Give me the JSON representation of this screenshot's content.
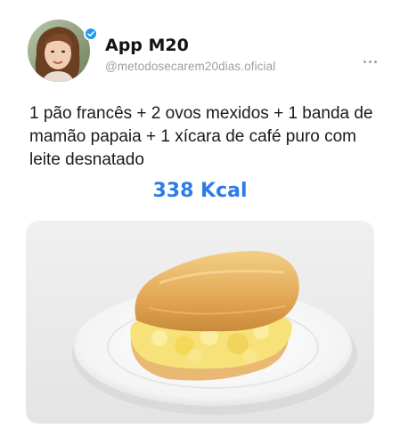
{
  "account": {
    "name": "App M20",
    "handle": "@metodosecarem20dias.oficial",
    "verified": true,
    "avatar_icon": "profile-photo-woman",
    "verified_color": "#1d9bf0"
  },
  "post": {
    "text": "1 pão francês + 2 ovos mexidos + 1 banda de mamão papaia + 1 xícara de café puro com leite desnatado",
    "calories": "338 Kcal",
    "calories_color": "#2f7be6",
    "image_icon": "bread-with-scrambled-eggs-photo"
  },
  "menu": {
    "icon": "more-options-icon"
  }
}
